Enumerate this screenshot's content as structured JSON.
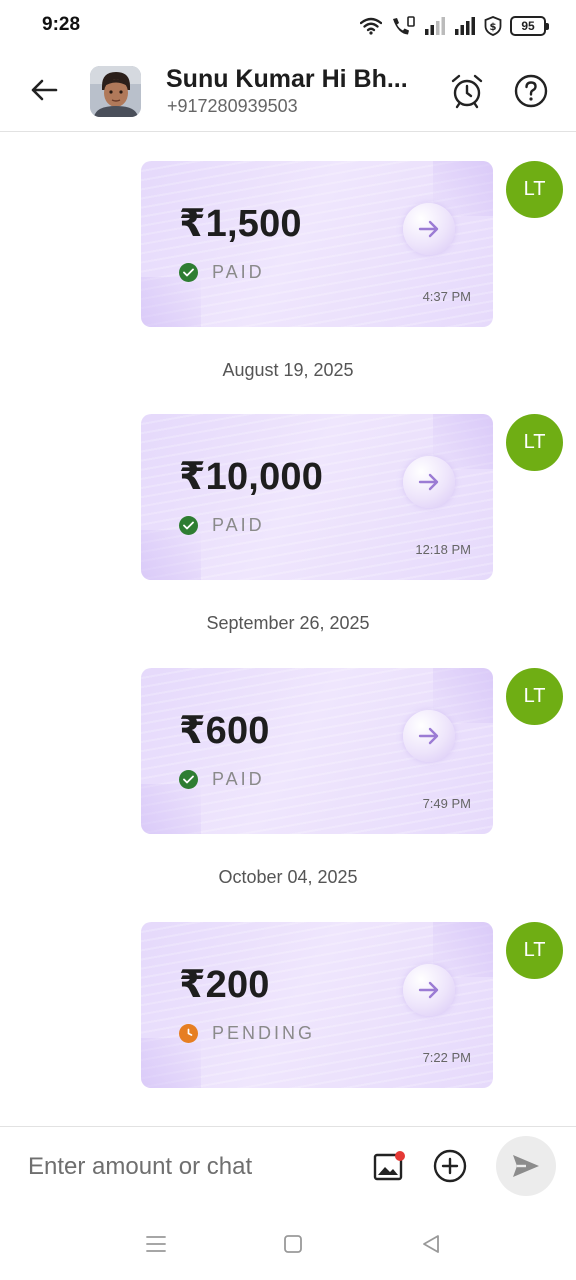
{
  "status_bar": {
    "time": "9:28",
    "battery": "95"
  },
  "header": {
    "contact_name": "Sunu Kumar Hi Bh...",
    "contact_phone": "+917280939503"
  },
  "messages": [
    {
      "amount": "₹1,500",
      "status": "PAID",
      "status_kind": "paid",
      "time": "4:37 PM",
      "sender": "LT"
    },
    {
      "date": "August 19, 2025"
    },
    {
      "amount": "₹10,000",
      "status": "PAID",
      "status_kind": "paid",
      "time": "12:18 PM",
      "sender": "LT"
    },
    {
      "date": "September 26, 2025"
    },
    {
      "amount": "₹600",
      "status": "PAID",
      "status_kind": "paid",
      "time": "7:49 PM",
      "sender": "LT"
    },
    {
      "date": "October 04, 2025"
    },
    {
      "amount": "₹200",
      "status": "PENDING",
      "status_kind": "pending",
      "time": "7:22 PM",
      "sender": "LT"
    }
  ],
  "input_bar": {
    "placeholder": "Enter amount or chat"
  },
  "colors": {
    "sender_badge": "#6fae14",
    "paid": "#2e7d32",
    "pending": "#e67e22",
    "card": "#ebe1fc"
  },
  "icons": {
    "back": "arrow-left-icon",
    "alarm": "alarm-clock-icon",
    "help": "question-circle-icon",
    "image": "image-icon",
    "add": "plus-circle-icon",
    "send": "send-icon",
    "nav_menu": "menu-icon",
    "nav_home": "square-icon",
    "nav_back": "triangle-back-icon"
  }
}
